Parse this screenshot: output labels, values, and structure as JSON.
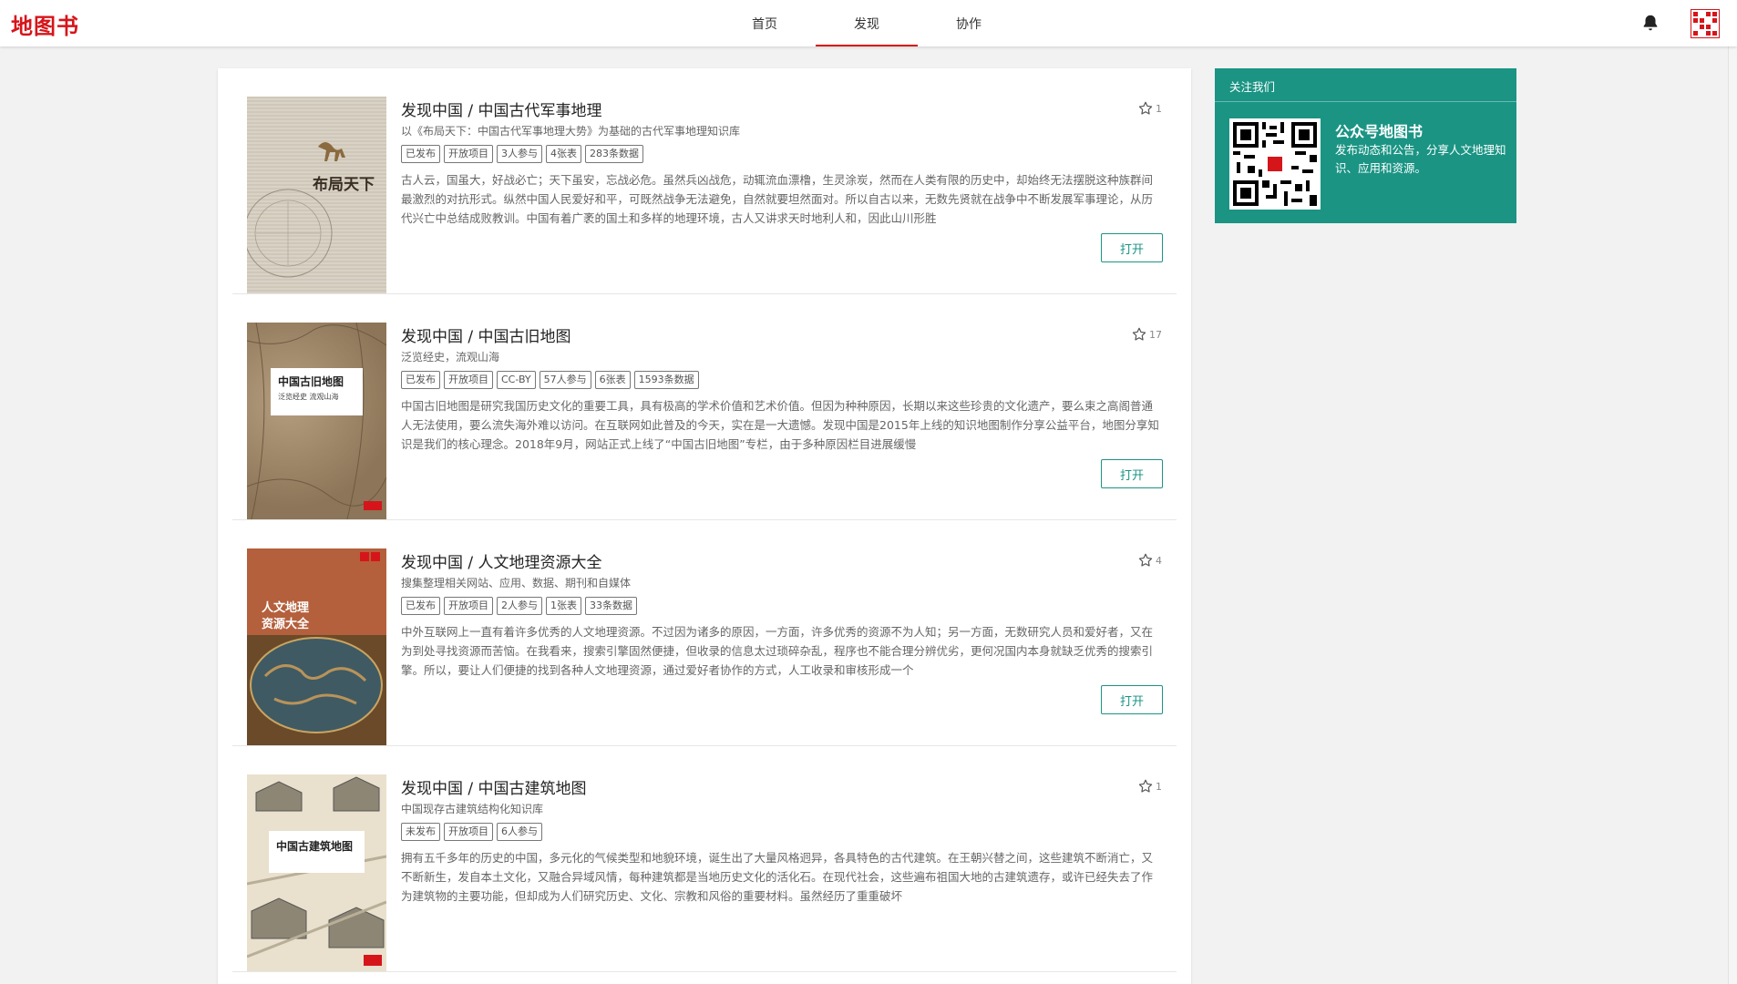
{
  "app": {
    "logo": "地图书"
  },
  "nav": {
    "tabs": [
      {
        "label": "首页"
      },
      {
        "label": "发现"
      },
      {
        "label": "协作"
      }
    ]
  },
  "projects": [
    {
      "title": "发现中国 / 中国古代军事地理",
      "subtitle": "以《布局天下：中国古代军事地理大势》为基础的古代军事地理知识库",
      "tags": [
        "已发布",
        "开放项目",
        "3人参与",
        "4张表",
        "283条数据"
      ],
      "description": "古人云，国虽大，好战必亡；天下虽安，忘战必危。虽然兵凶战危，动辄流血漂橹，生灵涂炭，然而在人类有限的历史中，却始终无法摆脱这种族群间最激烈的对抗形式。纵然中国人民爱好和平，可既然战争无法避免，自然就要坦然面对。所以自古以来，无数先贤就在战争中不断发展军事理论，从历代兴亡中总结成败教训。中国有着广袤的国土和多样的地理环境，古人又讲求天时地利人和，因此山川形胜",
      "stars": "1",
      "cover_title": "布局天下",
      "open_label": "打开"
    },
    {
      "title": "发现中国 / 中国古旧地图",
      "subtitle": "泛览经史，流观山海",
      "tags": [
        "已发布",
        "开放项目",
        "CC-BY",
        "57人参与",
        "6张表",
        "1593条数据"
      ],
      "description": "中国古旧地图是研究我国历史文化的重要工具，具有极高的学术价值和艺术价值。但因为种种原因，长期以来这些珍贵的文化遗产，要么束之高阁普通人无法使用，要么流失海外难以访问。在互联网如此普及的今天，实在是一大遗憾。发现中国是2015年上线的知识地图制作分享公益平台，地图分享知识是我们的核心理念。2018年9月，网站正式上线了“中国古旧地图”专栏，由于多种原因栏目进展缓慢",
      "stars": "17",
      "cover_title": "中国古旧地图",
      "cover_subtitle": "泛览经史 流观山海",
      "open_label": "打开"
    },
    {
      "title": "发现中国 / 人文地理资源大全",
      "subtitle": "搜集整理相关网站、应用、数据、期刊和自媒体",
      "tags": [
        "已发布",
        "开放项目",
        "2人参与",
        "1张表",
        "33条数据"
      ],
      "description": "中外互联网上一直有着许多优秀的人文地理资源。不过因为诸多的原因，一方面，许多优秀的资源不为人知；另一方面，无数研究人员和爱好者，又在为到处寻找资源而苦恼。在我看来，搜索引擎固然便捷，但收录的信息太过琐碎杂乱，程序也不能合理分辨优劣，更何况国内本身就缺乏优秀的搜索引擎。所以，要让人们便捷的找到各种人文地理资源，通过爱好者协作的方式，人工收录和审核形成一个",
      "stars": "4",
      "cover_title": "人文地理",
      "cover_title2": "资源大全",
      "open_label": "打开"
    },
    {
      "title": "发现中国 / 中国古建筑地图",
      "subtitle": "中国现存古建筑结构化知识库",
      "tags": [
        "未发布",
        "开放项目",
        "6人参与"
      ],
      "description": "拥有五千多年的历史的中国，多元化的气候类型和地貌环境，诞生出了大量风格迥异，各具特色的古代建筑。在王朝兴替之间，这些建筑不断消亡，又不断新生，发自本土文化，又融合异域风情，每种建筑都是当地历史文化的活化石。在现代社会，这些遍布祖国大地的古建筑遗存，或许已经失去了作为建筑物的主要功能，但却成为人们研究历史、文化、宗教和风俗的重要材料。虽然经历了重重破坏",
      "stars": "1",
      "cover_title": "中国古建筑地图",
      "open_label": "打开"
    }
  ],
  "sidebar": {
    "follow_heading": "关注我们",
    "account_name": "公众号地图书",
    "account_desc": "发布动态和公告，分享人文地理知识、应用和资源。"
  },
  "colors": {
    "brand_red": "#d6151a",
    "accent_teal": "#1b9484"
  }
}
